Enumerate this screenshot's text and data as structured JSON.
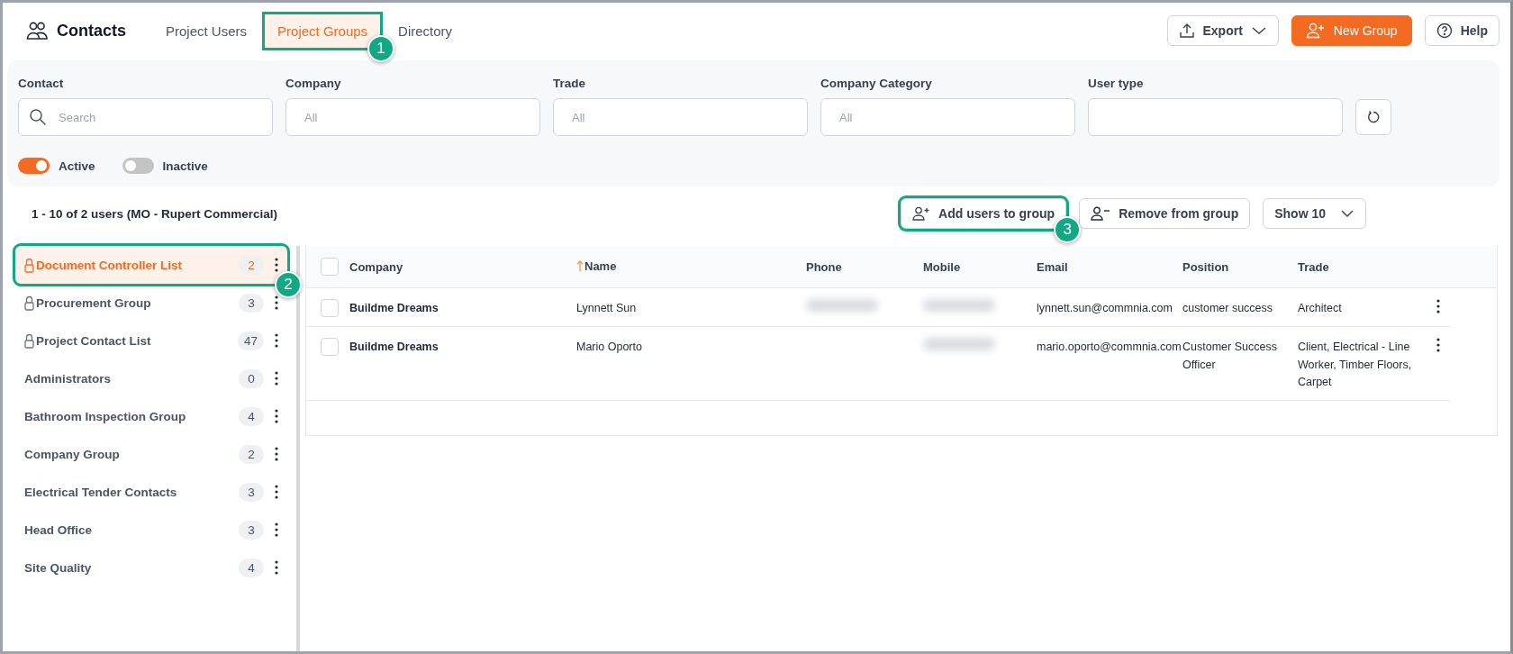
{
  "header": {
    "title": "Contacts",
    "tabs": [
      {
        "label": "Project Users",
        "selected": false
      },
      {
        "label": "Project Groups",
        "selected": true,
        "callout": "1"
      },
      {
        "label": "Directory",
        "selected": false
      }
    ],
    "actions": [
      {
        "kind": "export",
        "label": "Export"
      },
      {
        "kind": "new",
        "label": "New Group"
      },
      {
        "kind": "help",
        "label": "Help"
      }
    ]
  },
  "filters": {
    "fields": [
      {
        "label": "Contact",
        "placeholder": "Search",
        "kind": "search"
      },
      {
        "label": "Company",
        "placeholder": "All",
        "kind": "select"
      },
      {
        "label": "Trade",
        "placeholder": "All",
        "kind": "select"
      },
      {
        "label": "Company Category",
        "placeholder": "All",
        "kind": "select"
      },
      {
        "label": "User type",
        "kind": "select"
      }
    ],
    "toggles": [
      {
        "label": "Active",
        "on": true
      },
      {
        "label": "Inactive",
        "on": false
      }
    ]
  },
  "summary": "1 - 10 of 2 users (MO - Rupert Commercial)",
  "toolbar": [
    {
      "kind": "add",
      "label": "Add users to group",
      "callout": "3"
    },
    {
      "kind": "remove",
      "label": "Remove from group"
    },
    {
      "kind": "show",
      "label": "Show 10"
    }
  ],
  "groups": [
    {
      "name": "Document Controller List",
      "count": "2",
      "locked": true,
      "selected": true,
      "callout": "2"
    },
    {
      "name": "Procurement Group",
      "count": "3",
      "locked": true,
      "selected": false
    },
    {
      "name": "Project Contact List",
      "count": "47",
      "locked": true,
      "selected": false
    },
    {
      "name": "Administrators",
      "count": "0",
      "locked": false,
      "selected": false
    },
    {
      "name": "Bathroom Inspection Group",
      "count": "4",
      "locked": false,
      "selected": false
    },
    {
      "name": "Company Group",
      "count": "2",
      "locked": false,
      "selected": false
    },
    {
      "name": "Electrical Tender Contacts",
      "count": "3",
      "locked": false,
      "selected": false
    },
    {
      "name": "Head Office",
      "count": "3",
      "locked": false,
      "selected": false
    },
    {
      "name": "Site Quality",
      "count": "4",
      "locked": false,
      "selected": false
    }
  ],
  "table": {
    "select_all_checked": false,
    "columns": [
      {
        "label": "Company",
        "sorted": false
      },
      {
        "label": "Name",
        "sorted": true
      },
      {
        "label": "Phone",
        "sorted": false
      },
      {
        "label": "Mobile",
        "sorted": false
      },
      {
        "label": "Email",
        "sorted": false
      },
      {
        "label": "Position",
        "sorted": false
      },
      {
        "label": "Trade",
        "sorted": false
      }
    ],
    "rows": [
      {
        "checked": false,
        "company": "Buildme Dreams",
        "name": "Lynnett Sun",
        "phone_blurred": true,
        "mobile_blurred": true,
        "email": "lynnett.sun@commnia.com",
        "position": "customer success",
        "trade": "Architect"
      },
      {
        "checked": false,
        "company": "Buildme Dreams",
        "name": "Mario Oporto",
        "phone_blurred": false,
        "mobile_blurred": true,
        "email": "mario.oporto@commnia.com",
        "position": "Customer Success Officer",
        "trade": "Client, Electrical - Line Worker, Timber Floors, Carpet"
      }
    ]
  }
}
